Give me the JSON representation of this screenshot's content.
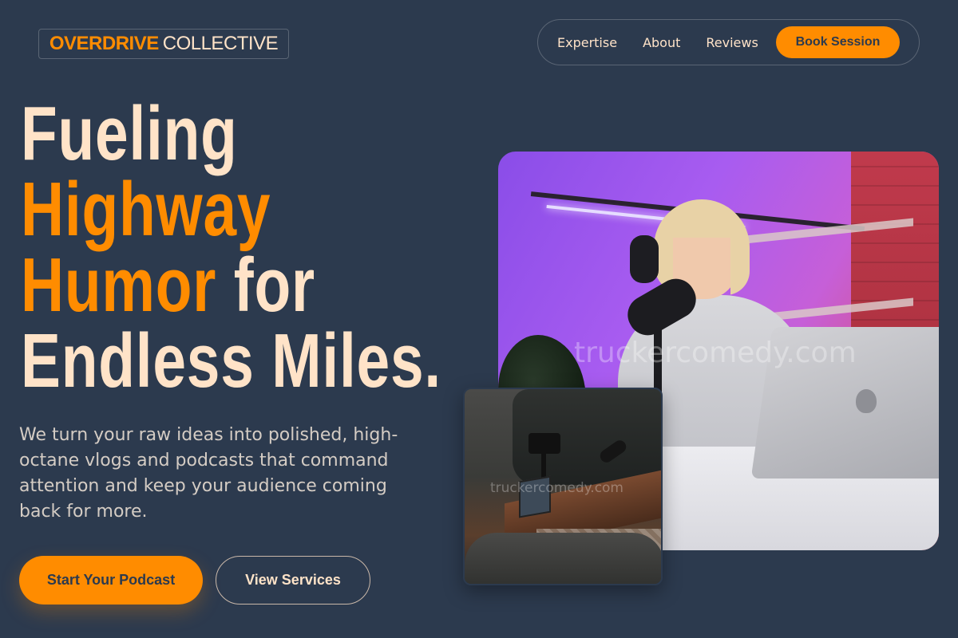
{
  "header": {
    "logo_strong": "OVERDRIVE",
    "logo_light": "COLLECTIVE",
    "nav": [
      {
        "label": "Expertise"
      },
      {
        "label": "About"
      },
      {
        "label": "Reviews"
      }
    ],
    "cta_label": "Book Session"
  },
  "hero": {
    "headline_line1": "Fueling",
    "headline_line2": "Highway",
    "headline_line3_accent": "Humor",
    "headline_line3_rest": " for",
    "headline_line4": "Endless Miles.",
    "subtext": "We turn your raw ideas into polished, high-octane vlogs and podcasts that command attention and keep your audience coming back for more.",
    "primary_button": "Start Your Podcast",
    "secondary_button": "View Services"
  },
  "media": {
    "main_watermark": "truckercomedy.com",
    "secondary_watermark": "truckercomedy.com"
  },
  "colors": {
    "background": "#2c3a4e",
    "accent": "#ff8c00",
    "cream": "#ffe3c8"
  }
}
